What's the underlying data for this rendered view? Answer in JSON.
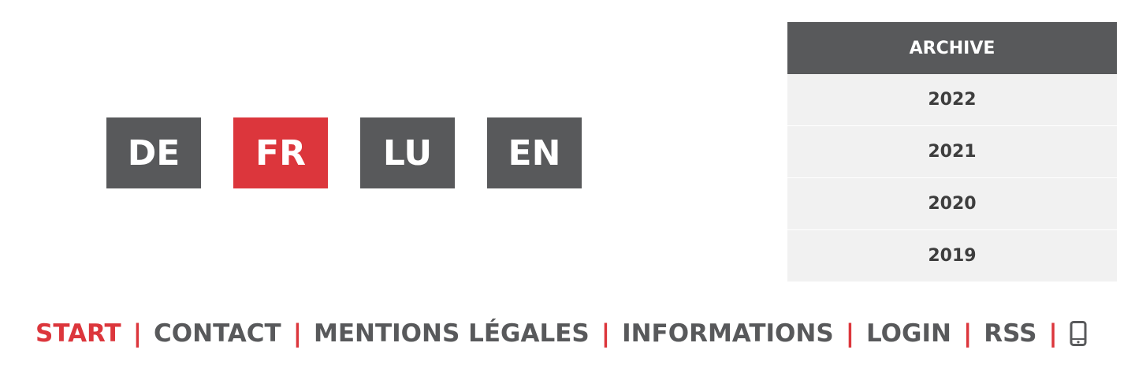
{
  "languages": [
    {
      "code": "DE",
      "active": false
    },
    {
      "code": "FR",
      "active": true
    },
    {
      "code": "LU",
      "active": false
    },
    {
      "code": "EN",
      "active": false
    }
  ],
  "archive": {
    "title": "ARCHIVE",
    "years": [
      "2022",
      "2021",
      "2020",
      "2019"
    ]
  },
  "footer": {
    "links": [
      "START",
      "CONTACT",
      "MENTIONS LÉGALES",
      "INFORMATIONS",
      "LOGIN",
      "RSS"
    ],
    "active_link": "START",
    "separator": "|",
    "mobile_icon": "mobile-phone-icon"
  },
  "colors": {
    "accent": "#dc363c",
    "dark_gray": "#58595b",
    "panel_bg": "#f1f1f1"
  }
}
